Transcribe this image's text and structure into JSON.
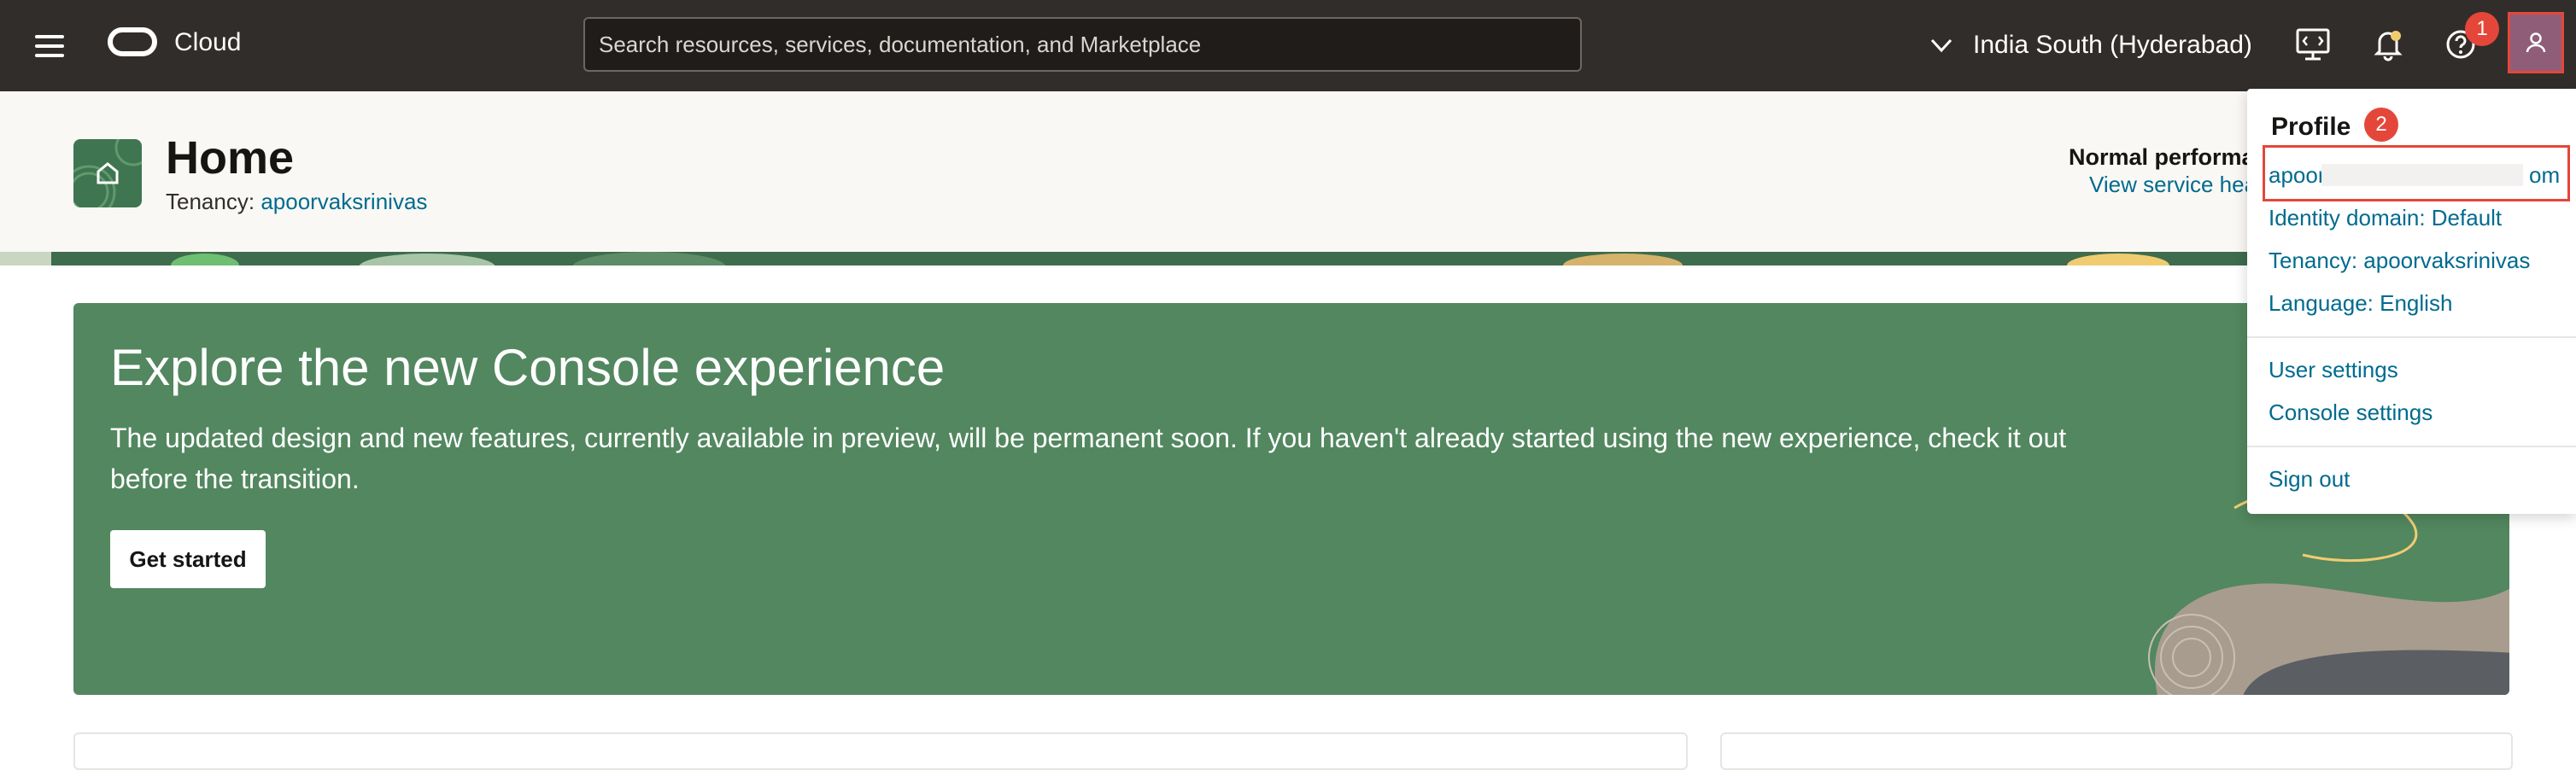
{
  "topbar": {
    "brand": "Cloud",
    "search_placeholder": "Search resources, services, documentation, and Marketplace",
    "region": "India South (Hyderabad)",
    "help_badge": "1"
  },
  "header": {
    "title": "Home",
    "tenancy_label": "Tenancy:",
    "tenancy_value": "apoorvaksrinivas",
    "performance_title": "Normal performance",
    "performance_link": "View service health"
  },
  "banner": {
    "title": "Explore the new Console experience",
    "text": "The updated design and new features, currently available in preview, will be permanent soon. If you haven't already started using the new experience, check it out before the transition.",
    "button": "Get started"
  },
  "profile_menu": {
    "title": "Profile",
    "badge": "2",
    "email_start": "apoor",
    "email_end": "om",
    "identity_domain": "Identity domain: Default",
    "tenancy": "Tenancy: apoorvaksrinivas",
    "language": "Language: English",
    "user_settings": "User settings",
    "console_settings": "Console settings",
    "sign_out": "Sign out"
  },
  "colors": {
    "topbar": "#312d2a",
    "banner": "#52875f",
    "link": "#006b8f",
    "highlight": "#e4473a"
  }
}
